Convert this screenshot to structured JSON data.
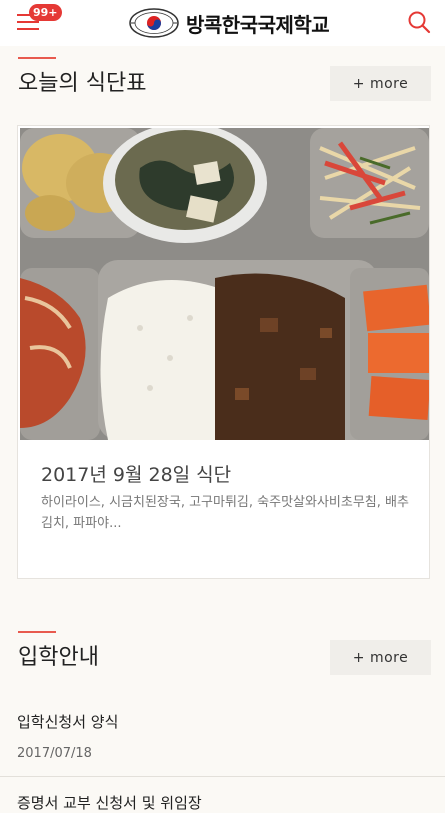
{
  "header": {
    "menu_icon": "hamburger-icon",
    "badge": "99+",
    "school_name": "방콕한국국제학교",
    "search_icon": "search-icon",
    "accent_color": "#e53935"
  },
  "meal_section": {
    "title": "오늘의 식단표",
    "more_label": "+ more",
    "card": {
      "date_title": "2017년 9월 28일 식단",
      "menu_text": "하이라이스, 시금치된장국, 고구마튀김, 숙주맛살와사비초무침, 배추김치, 파파야..."
    }
  },
  "admission_section": {
    "title": "입학안내",
    "more_label": "+ more",
    "items": [
      {
        "title": "입학신청서 양식",
        "date": "2017/07/18"
      },
      {
        "title": "증명서 교부 신청서 및 위임장"
      }
    ]
  }
}
